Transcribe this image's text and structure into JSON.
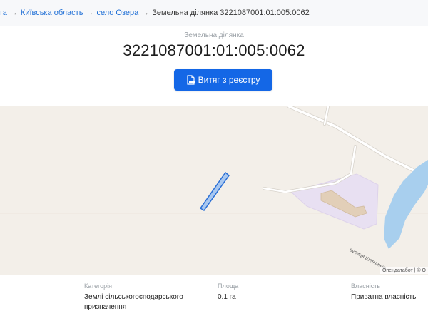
{
  "breadcrumb": {
    "items": [
      "ота",
      "Київська область",
      "село Озера"
    ],
    "current": "Земельна ділянка 3221087001:01:005:0062",
    "separator": "→"
  },
  "header": {
    "subtitle": "Земельна ділянка",
    "title": "3221087001:01:005:0062",
    "extract_button": "Витяг з реєстру"
  },
  "map": {
    "street_label": "вулиця Шевченка",
    "attribution": "Опендатабот | © O"
  },
  "info": {
    "category_label": "Категорія",
    "category_value": "Землі сільськогосподарського призначення",
    "area_label": "Площа",
    "area_value": "0.1 га",
    "ownership_label": "Власність",
    "ownership_value": "Приватна власність"
  },
  "colors": {
    "accent": "#1467e6",
    "link": "#1f6fd6",
    "parcel_fill": "#a9c8f0",
    "parcel_stroke": "#2a6fd6",
    "water": "#a8cfee",
    "residential": "#e8e0f2"
  },
  "icons": {
    "extract_button_icon": "document-pdf-icon"
  }
}
